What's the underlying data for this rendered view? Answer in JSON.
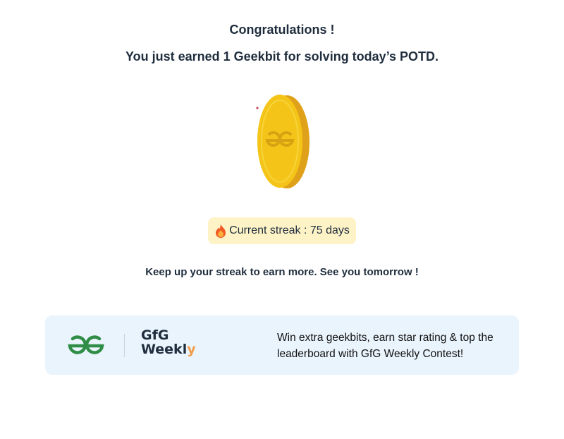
{
  "dialog": {
    "title": "Congratulations !",
    "subtitle": "You just earned 1 Geekbit for solving today’s POTD.",
    "coin_icon": "geekbit-coin-icon",
    "streak": {
      "icon": "fire-icon",
      "label": "Current streak : 75 days"
    },
    "message": "Keep up your streak to earn more. See you tomorrow !"
  },
  "banner": {
    "logo_icon": "gfg-logo-icon",
    "weekly_logo": {
      "line1": "GfG",
      "line2_main": "Weekl",
      "line2_accent": "y"
    },
    "text": "Win extra geekbits, earn star rating & top the leaderboard with GfG Weekly Contest!"
  },
  "colors": {
    "coin": "#f4c518",
    "coin_edge": "#e0a11a",
    "streak_bg": "#fdf3c7",
    "banner_bg": "#eaf4fd",
    "gfg_green": "#2f8d46"
  }
}
